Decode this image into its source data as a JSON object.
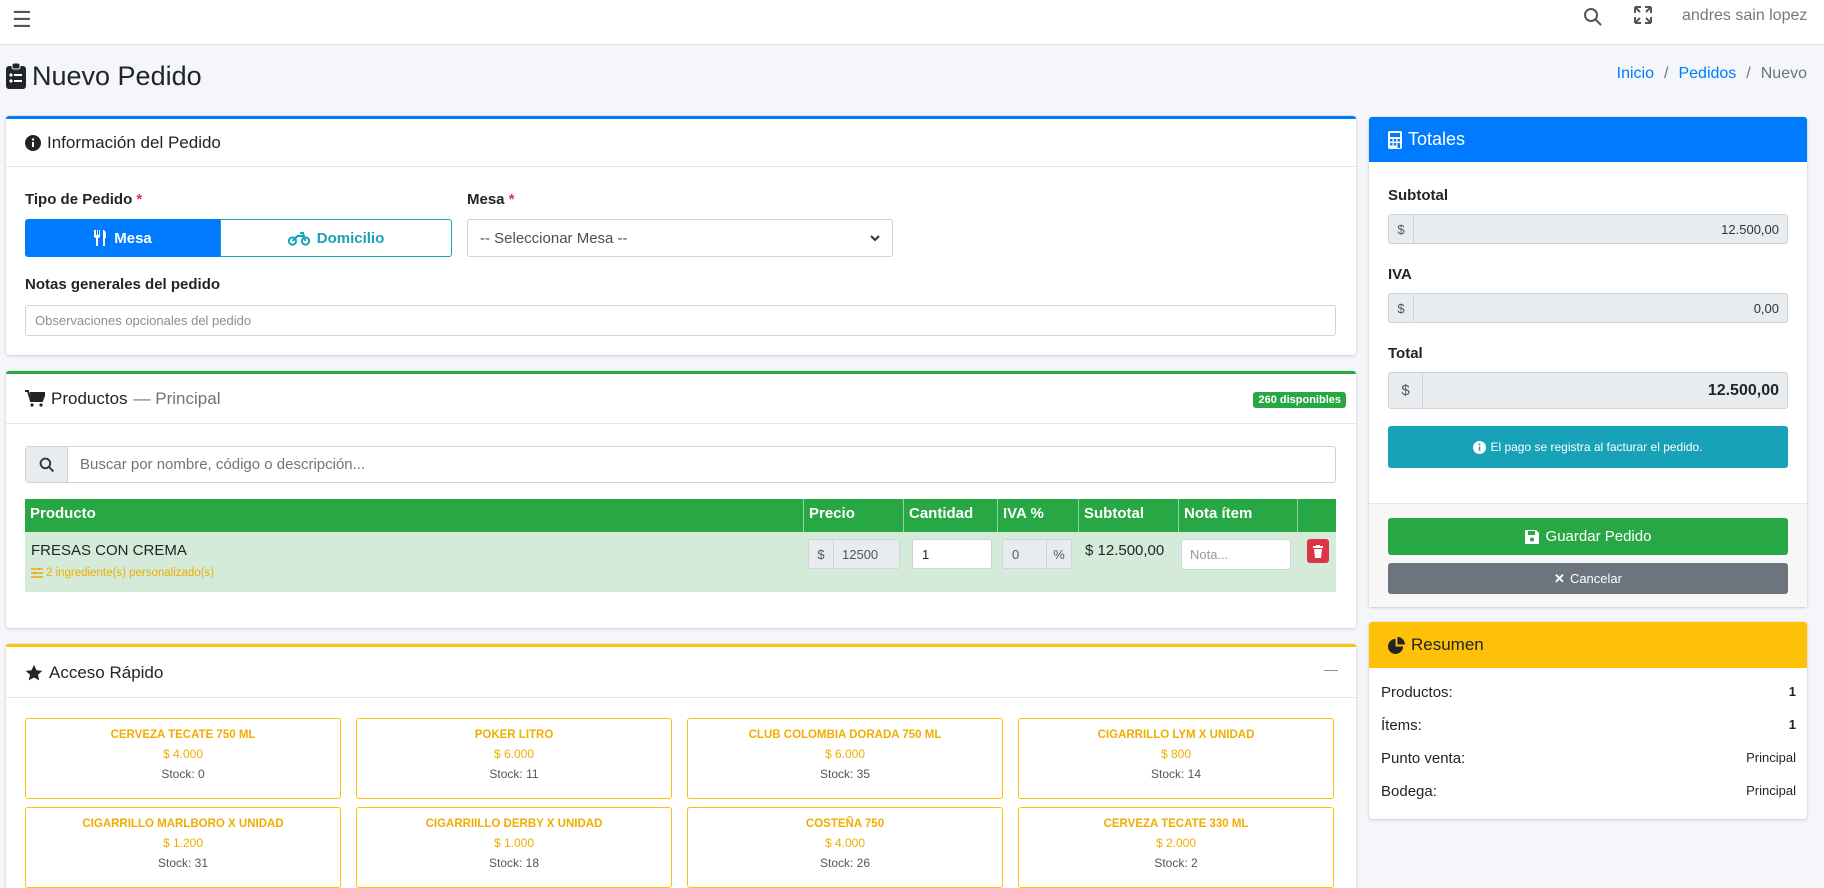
{
  "topbar": {
    "menu_icon": "hamburger-icon",
    "user_name": "andres sain lopez"
  },
  "page": {
    "title": "Nuevo Pedido",
    "title_icon": "clipboard-list-icon"
  },
  "breadcrumb": {
    "items": [
      "Inicio",
      "Pedidos",
      "Nuevo"
    ]
  },
  "info_card": {
    "title": "Información del Pedido",
    "tipo_label": "Tipo de Pedido",
    "required_mark": "*",
    "mesa_btn": "Mesa",
    "domicilio_btn": "Domicilio",
    "mesa_label": "Mesa",
    "mesa_select": "-- Seleccionar Mesa --",
    "notes_label": "Notas generales del pedido",
    "notes_placeholder": "Observaciones opcionales del pedido"
  },
  "products_card": {
    "title": "Productos",
    "subtitle": "— Principal",
    "badge": "260 disponibles",
    "search_placeholder": "Buscar por nombre, código o descripción...",
    "columns": [
      "Producto",
      "Precio",
      "Cantidad",
      "IVA %",
      "Subtotal",
      "Nota ítem",
      ""
    ],
    "rows": [
      {
        "product": "FRESAS CON CREMA",
        "custom": "2 ingrediente(s) personalizado(s)",
        "currency": "$",
        "price": "12500",
        "qty": "1",
        "iva": "0",
        "pct": "%",
        "subtotal": "$ 12.500,00",
        "note_placeholder": "Nota..."
      }
    ]
  },
  "quick_card": {
    "title": "Acceso Rápido",
    "collapse": "—",
    "items": [
      {
        "name": "CERVEZA TECATE 750 ML",
        "price": "$ 4.000",
        "stock": "Stock: 0"
      },
      {
        "name": "POKER LITRO",
        "price": "$ 6.000",
        "stock": "Stock: 11"
      },
      {
        "name": "CLUB COLOMBIA DORADA 750 ML",
        "price": "$ 6.000",
        "stock": "Stock: 35"
      },
      {
        "name": "CIGARRILLO LYM X UNIDAD",
        "price": "$ 800",
        "stock": "Stock: 14"
      },
      {
        "name": "CIGARRILLO MARLBORO X UNIDAD",
        "price": "$ 1.200",
        "stock": "Stock: 31"
      },
      {
        "name": "CIGARRIILLO DERBY X UNIDAD",
        "price": "$ 1.000",
        "stock": "Stock: 18"
      },
      {
        "name": "COSTEÑA 750",
        "price": "$ 4.000",
        "stock": "Stock: 26"
      },
      {
        "name": "CERVEZA TECATE 330 ML",
        "price": "$ 2.000",
        "stock": "Stock: 2"
      }
    ]
  },
  "totals_card": {
    "title": "Totales",
    "currency": "$",
    "subtotal_label": "Subtotal",
    "subtotal": "12.500,00",
    "iva_label": "IVA",
    "iva": "0,00",
    "total_label": "Total",
    "total": "12.500,00",
    "info": "El pago se registra al facturar el pedido.",
    "save_btn": "Guardar Pedido",
    "cancel_btn": "Cancelar"
  },
  "summary_card": {
    "title": "Resumen",
    "rows": [
      {
        "label": "Productos:",
        "value": "1"
      },
      {
        "label": "Ítems:",
        "value": "1"
      },
      {
        "label": "Punto venta:",
        "value": "Principal"
      },
      {
        "label": "Bodega:",
        "value": "Principal"
      }
    ]
  },
  "colors": {
    "primary": "#007bff",
    "success": "#28a745",
    "warning": "#ffc107",
    "info": "#17a2b8",
    "danger": "#dc3545",
    "secondary": "#6c757d"
  }
}
